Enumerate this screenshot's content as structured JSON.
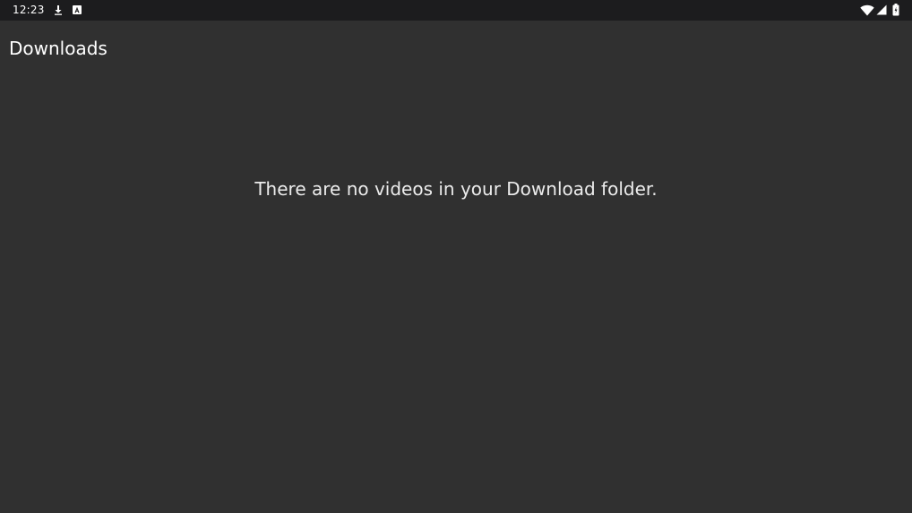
{
  "status_bar": {
    "time": "12:23",
    "left_icons": [
      "download-icon",
      "notification-a-icon"
    ],
    "right_icons": [
      "wifi-icon",
      "cellular-signal-icon",
      "battery-icon"
    ]
  },
  "app_bar": {
    "title": "Downloads"
  },
  "main": {
    "empty_message": "There are no videos in your Download folder."
  },
  "colors": {
    "background": "#303030",
    "status_bar": "#1c1c1e",
    "text": "#ffffff"
  }
}
